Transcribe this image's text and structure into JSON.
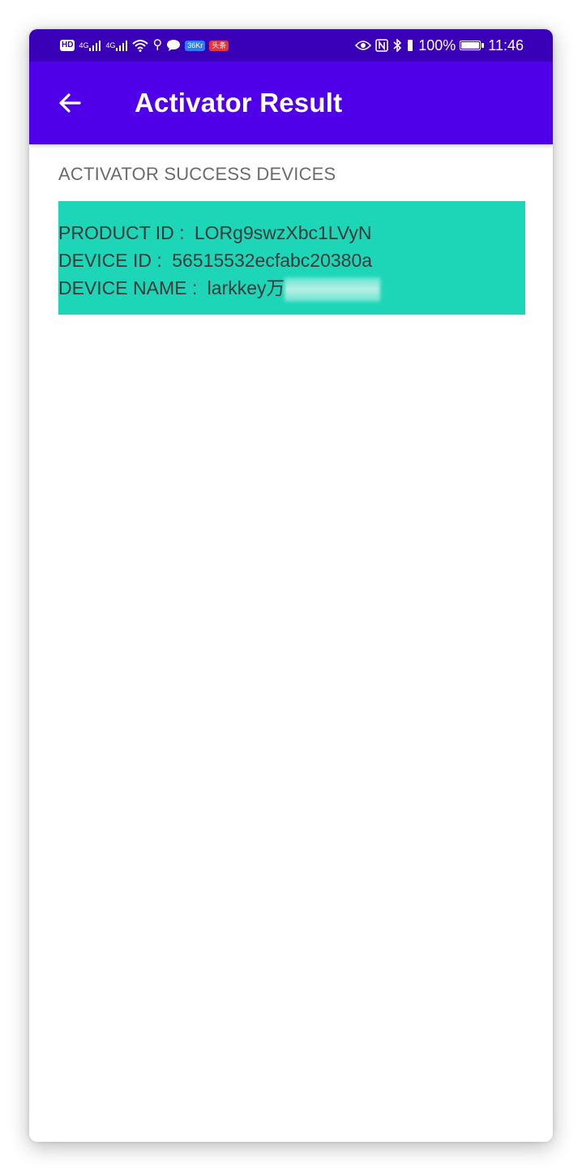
{
  "status_bar": {
    "hd_label": "HD",
    "signal_1_label": "4G",
    "signal_2_label": "4G",
    "app_badge_1": "36Kr",
    "app_badge_2": "头条",
    "battery_text": "100%",
    "battery_level": 1.0,
    "time": "11:46"
  },
  "app_bar": {
    "title": "Activator Result",
    "background_color": "#5000e8",
    "status_bar_color": "#3a00b8"
  },
  "section": {
    "header": "ACTIVATOR SUCCESS DEVICES"
  },
  "devices": [
    {
      "product_id_label": "PRODUCT ID :",
      "product_id": "LORg9swzXbc1LVyN",
      "device_id_label": "DEVICE ID :",
      "device_id": "56515532ecfabc20380a",
      "device_name_label": "DEVICE NAME :",
      "device_name": "larkkey万",
      "card_color": "#1dd6b8"
    }
  ]
}
